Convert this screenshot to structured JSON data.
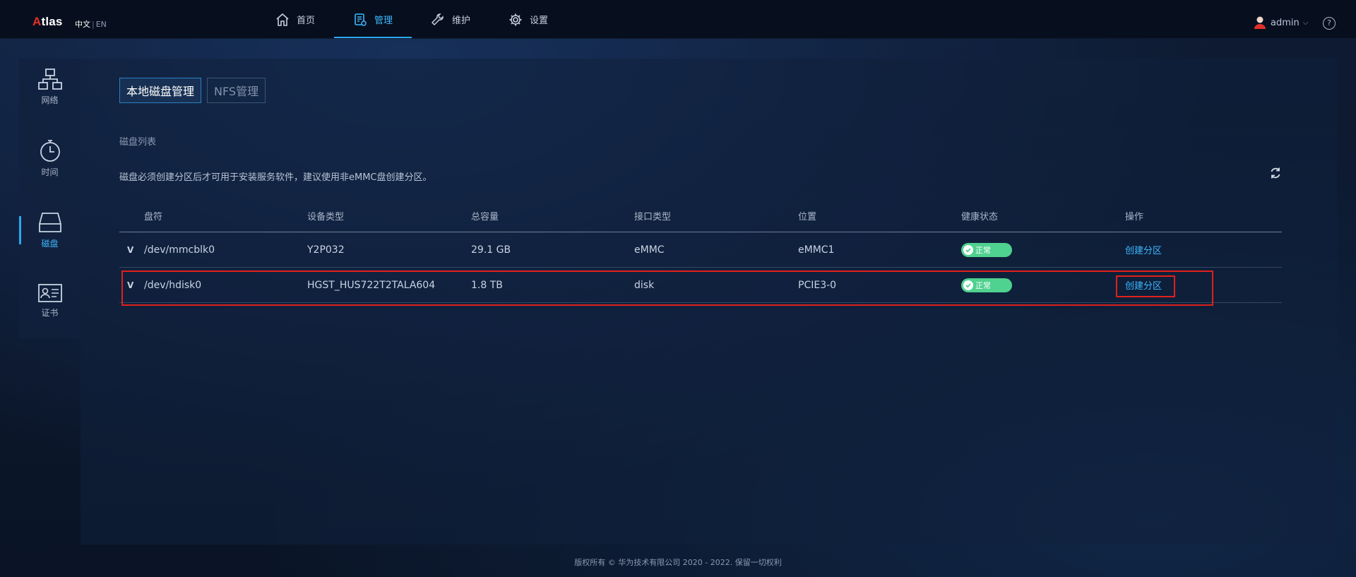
{
  "app": {
    "logo_prefix": "A",
    "logo_rest": "tlas",
    "lang_cn": "中文",
    "lang_sep": "|",
    "lang_en": "EN"
  },
  "nav": [
    {
      "label": "首页",
      "icon": "home-icon"
    },
    {
      "label": "管理",
      "icon": "manage-icon",
      "active": true
    },
    {
      "label": "维护",
      "icon": "wrench-icon"
    },
    {
      "label": "设置",
      "icon": "gear-icon"
    }
  ],
  "user": {
    "name": "admin",
    "help": "?"
  },
  "sidebar": [
    {
      "label": "网络",
      "icon": "network-icon"
    },
    {
      "label": "时间",
      "icon": "clock-icon"
    },
    {
      "label": "磁盘",
      "icon": "disk-icon",
      "active": true
    },
    {
      "label": "证书",
      "icon": "certificate-icon"
    }
  ],
  "tabs": [
    {
      "label": "本地磁盘管理",
      "active": true
    },
    {
      "label": "NFS管理"
    }
  ],
  "main": {
    "section_title": "磁盘列表",
    "hint": "磁盘必须创建分区后才可用于安装服务软件，建议使用非eMMC盘创建分区。"
  },
  "table": {
    "headers": [
      "盘符",
      "设备类型",
      "总容量",
      "接口类型",
      "位置",
      "健康状态",
      "操作"
    ],
    "rows": [
      {
        "expand": "V",
        "drive": "/dev/mmcblk0",
        "type": "Y2P032",
        "capacity": "29.1 GB",
        "interface": "eMMC",
        "location": "eMMC1",
        "health": "正常",
        "action": "创建分区"
      },
      {
        "expand": "V",
        "drive": "/dev/hdisk0",
        "type": "HGST_HUS722T2TALA604",
        "capacity": "1.8 TB",
        "interface": "disk",
        "location": "PCIE3-0",
        "health": "正常",
        "action": "创建分区"
      }
    ]
  },
  "footer": "版权所有 © 华为技术有限公司 2020 - 2022. 保留一切权利",
  "colors": {
    "accent": "#2aa8ef",
    "health_ok": "#4fd18f",
    "highlight": "#e0201c",
    "logo_red": "#e8302a"
  }
}
